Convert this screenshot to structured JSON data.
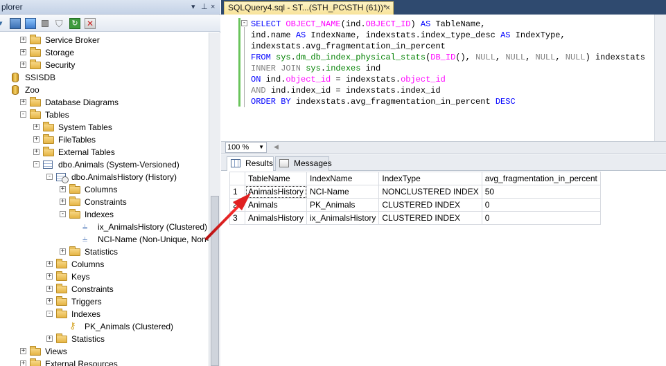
{
  "object_explorer": {
    "title": "plorer",
    "tree": [
      {
        "label": "Service Broker",
        "indent": 1,
        "icon": "folder-icon",
        "expander": "+"
      },
      {
        "label": "Storage",
        "indent": 1,
        "icon": "folder-icon",
        "expander": "+"
      },
      {
        "label": "Security",
        "indent": 1,
        "icon": "folder-icon",
        "expander": "+"
      },
      {
        "label": "SSISDB",
        "indent": 0,
        "icon": "database-icon",
        "expander": ""
      },
      {
        "label": "Zoo",
        "indent": 0,
        "icon": "database-icon",
        "expander": ""
      },
      {
        "label": "Database Diagrams",
        "indent": 1,
        "icon": "folder-icon",
        "expander": "+"
      },
      {
        "label": "Tables",
        "indent": 1,
        "icon": "folder-icon",
        "expander": "-"
      },
      {
        "label": "System Tables",
        "indent": 2,
        "icon": "folder-icon",
        "expander": "+"
      },
      {
        "label": "FileTables",
        "indent": 2,
        "icon": "folder-icon",
        "expander": "+"
      },
      {
        "label": "External Tables",
        "indent": 2,
        "icon": "folder-icon",
        "expander": "+"
      },
      {
        "label": "dbo.Animals (System-Versioned)",
        "indent": 2,
        "icon": "table-icon",
        "expander": "-"
      },
      {
        "label": "dbo.AnimalsHistory (History)",
        "indent": 3,
        "icon": "history-table-icon",
        "expander": "-"
      },
      {
        "label": "Columns",
        "indent": 4,
        "icon": "folder-icon",
        "expander": "+"
      },
      {
        "label": "Constraints",
        "indent": 4,
        "icon": "folder-icon",
        "expander": "+"
      },
      {
        "label": "Indexes",
        "indent": 4,
        "icon": "folder-icon",
        "expander": "-"
      },
      {
        "label": "ix_AnimalsHistory (Clustered)",
        "indent": 5,
        "icon": "index-icon",
        "expander": ""
      },
      {
        "label": "NCI-Name (Non-Unique, Non-Cl",
        "indent": 5,
        "icon": "index-icon",
        "expander": ""
      },
      {
        "label": "Statistics",
        "indent": 4,
        "icon": "folder-icon",
        "expander": "+"
      },
      {
        "label": "Columns",
        "indent": 3,
        "icon": "folder-icon",
        "expander": "+"
      },
      {
        "label": "Keys",
        "indent": 3,
        "icon": "folder-icon",
        "expander": "+"
      },
      {
        "label": "Constraints",
        "indent": 3,
        "icon": "folder-icon",
        "expander": "+"
      },
      {
        "label": "Triggers",
        "indent": 3,
        "icon": "folder-icon",
        "expander": "+"
      },
      {
        "label": "Indexes",
        "indent": 3,
        "icon": "folder-icon",
        "expander": "-"
      },
      {
        "label": "PK_Animals (Clustered)",
        "indent": 4,
        "icon": "key-icon",
        "expander": ""
      },
      {
        "label": "Statistics",
        "indent": 3,
        "icon": "folder-icon",
        "expander": "+"
      },
      {
        "label": "Views",
        "indent": 1,
        "icon": "folder-icon",
        "expander": "+"
      },
      {
        "label": "External Resources",
        "indent": 1,
        "icon": "folder-icon",
        "expander": "+"
      }
    ]
  },
  "document_tab": {
    "title": "SQLQuery4.sql - ST...(STH_PC\\STH (61))*",
    "close": "×"
  },
  "editor": {
    "collapse_symbol": "-",
    "lines": [
      [
        {
          "t": "SELECT ",
          "c": "kw"
        },
        {
          "t": "OBJECT_NAME",
          "c": "fn"
        },
        {
          "t": "(ind.",
          "c": ""
        },
        {
          "t": "OBJECT_ID",
          "c": "fn"
        },
        {
          "t": ") ",
          "c": ""
        },
        {
          "t": "AS",
          "c": "kw"
        },
        {
          "t": " TableName,",
          "c": ""
        }
      ],
      [
        {
          "t": "ind.name ",
          "c": ""
        },
        {
          "t": "AS",
          "c": "kw"
        },
        {
          "t": " IndexName, indexstats.index_type_desc ",
          "c": ""
        },
        {
          "t": "AS",
          "c": "kw"
        },
        {
          "t": " IndexType,",
          "c": ""
        }
      ],
      [
        {
          "t": "indexstats.avg_fragmentation_in_percent",
          "c": ""
        }
      ],
      [
        {
          "t": "FROM ",
          "c": "kw"
        },
        {
          "t": "sys",
          "c": "sy"
        },
        {
          "t": ".",
          "c": ""
        },
        {
          "t": "dm_db_index_physical_stats",
          "c": "sy"
        },
        {
          "t": "(",
          "c": ""
        },
        {
          "t": "DB_ID",
          "c": "fn"
        },
        {
          "t": "(), ",
          "c": ""
        },
        {
          "t": "NULL",
          "c": "gy"
        },
        {
          "t": ", ",
          "c": ""
        },
        {
          "t": "NULL",
          "c": "gy"
        },
        {
          "t": ", ",
          "c": ""
        },
        {
          "t": "NULL",
          "c": "gy"
        },
        {
          "t": ", ",
          "c": ""
        },
        {
          "t": "NULL",
          "c": "gy"
        },
        {
          "t": ") indexstats",
          "c": ""
        }
      ],
      [
        {
          "t": "INNER JOIN ",
          "c": "gy"
        },
        {
          "t": "sys",
          "c": "sy"
        },
        {
          "t": ".",
          "c": ""
        },
        {
          "t": "indexes",
          "c": "sy"
        },
        {
          "t": " ind",
          "c": ""
        }
      ],
      [
        {
          "t": "ON ",
          "c": "kw"
        },
        {
          "t": "ind.",
          "c": ""
        },
        {
          "t": "object_id",
          "c": "pk"
        },
        {
          "t": " = indexstats.",
          "c": ""
        },
        {
          "t": "object_id",
          "c": "pk"
        }
      ],
      [
        {
          "t": "AND ",
          "c": "gy"
        },
        {
          "t": "ind.index_id = indexstats.index_id",
          "c": ""
        }
      ],
      [
        {
          "t": "ORDER BY ",
          "c": "kw"
        },
        {
          "t": "indexstats.avg_fragmentation_in_percent ",
          "c": ""
        },
        {
          "t": "DESC",
          "c": "kw"
        }
      ]
    ]
  },
  "zoom": {
    "value": "100 %"
  },
  "results_tabs": {
    "results_label": "Results",
    "messages_label": "Messages"
  },
  "grid": {
    "columns": [
      "TableName",
      "IndexName",
      "IndexType",
      "avg_fragmentation_in_percent"
    ],
    "rows": [
      {
        "num": "1",
        "cells": [
          "AnimalsHistory",
          "NCI-Name",
          "NONCLUSTERED INDEX",
          "50"
        ]
      },
      {
        "num": "2",
        "cells": [
          "Animals",
          "PK_Animals",
          "CLUSTERED INDEX",
          "0"
        ]
      },
      {
        "num": "3",
        "cells": [
          "AnimalsHistory",
          "ix_AnimalsHistory",
          "CLUSTERED INDEX",
          "0"
        ]
      }
    ]
  },
  "colors": {
    "keyword": "#0000ff",
    "function": "#ff00ff",
    "system_object": "#008000",
    "operator": "#808080",
    "tab_active": "#f8e39a",
    "annotation_arrow": "#e02020"
  }
}
